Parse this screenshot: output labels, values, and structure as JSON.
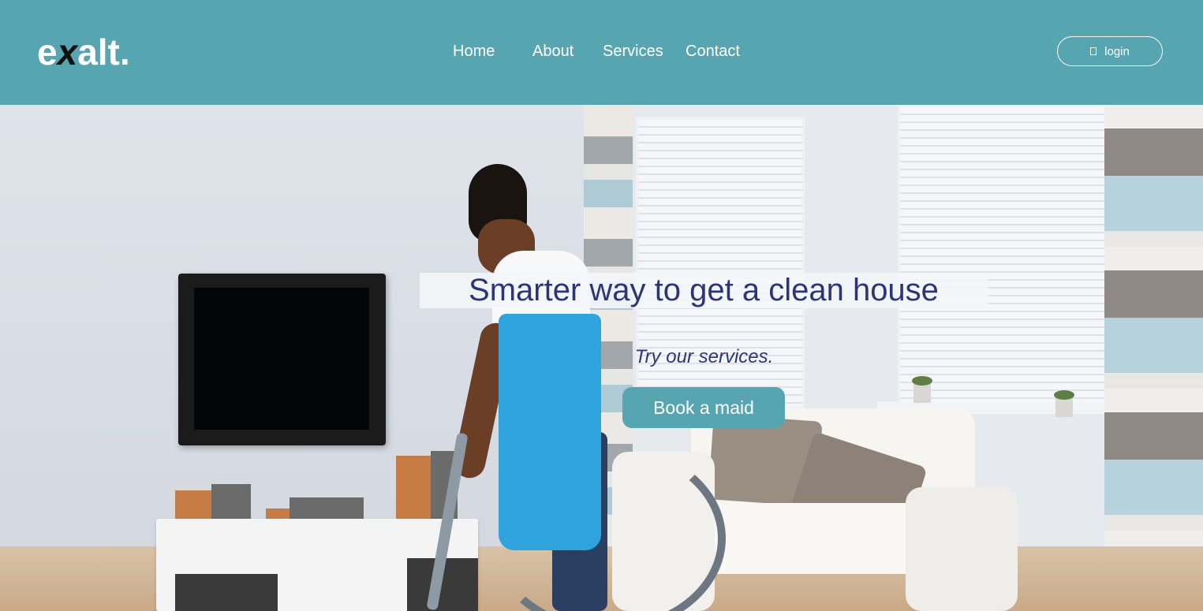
{
  "brand": {
    "logo_e": "e",
    "logo_x": "x",
    "logo_rest": "alt."
  },
  "nav": {
    "items": [
      "Home",
      "About",
      "Services",
      "Contact"
    ]
  },
  "header": {
    "login_label": "login",
    "login_icon": "user-icon"
  },
  "hero": {
    "headline": "Smarter way to get a clean house",
    "tagline": "Try our services.",
    "cta_label": "Book a maid",
    "image": "woman-vacuuming-living-room"
  },
  "colors": {
    "primary": "#58a5b2",
    "headline_text": "#2c3575",
    "white": "#ffffff"
  }
}
